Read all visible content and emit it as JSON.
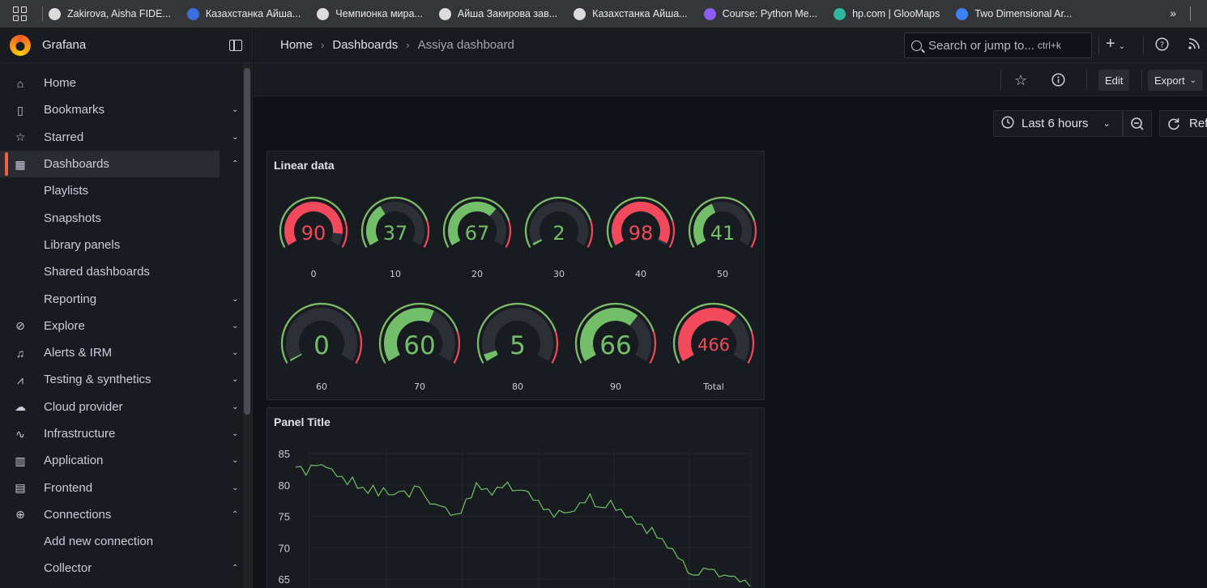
{
  "browser": {
    "bookmarks": [
      {
        "label": "Zakirova, Aisha FIDE...",
        "color": "#dcdcdc"
      },
      {
        "label": "Казахстанка Айша...",
        "color": "#3b6fe0"
      },
      {
        "label": "Чемпионка мира...",
        "color": "#dcdcdc"
      },
      {
        "label": "Айша Закирова зав...",
        "color": "#dcdcdc"
      },
      {
        "label": "Казахстанка Айша...",
        "color": "#dcdcdc"
      },
      {
        "label": "Course: Python Me...",
        "color": "#8b5cf6"
      },
      {
        "label": "hp.com | GlooMaps",
        "color": "#2fb5a0"
      },
      {
        "label": "Two Dimensional Ar...",
        "color": "#3b82f6"
      }
    ],
    "more": "»"
  },
  "sidebar": {
    "brand": "Grafana",
    "items": [
      {
        "label": "Home",
        "icon": "home-icon",
        "glyph": "⌂",
        "chev": ""
      },
      {
        "label": "Bookmarks",
        "icon": "bookmark-icon",
        "glyph": "▯",
        "chev": "⌄"
      },
      {
        "label": "Starred",
        "icon": "star-icon",
        "glyph": "☆",
        "chev": "⌄"
      },
      {
        "label": "Dashboards",
        "icon": "dashboards-icon",
        "glyph": "▦",
        "chev": "⌃",
        "active": true
      },
      {
        "label": "Playlists",
        "icon": "",
        "glyph": "",
        "chev": ""
      },
      {
        "label": "Snapshots",
        "icon": "",
        "glyph": "",
        "chev": ""
      },
      {
        "label": "Library panels",
        "icon": "",
        "glyph": "",
        "chev": ""
      },
      {
        "label": "Shared dashboards",
        "icon": "",
        "glyph": "",
        "chev": ""
      },
      {
        "label": "Reporting",
        "icon": "",
        "glyph": "",
        "chev": "⌄"
      },
      {
        "label": "Explore",
        "icon": "compass-icon",
        "glyph": "⊘",
        "chev": "⌄"
      },
      {
        "label": "Alerts & IRM",
        "icon": "bell-icon",
        "glyph": "♫",
        "chev": "⌄"
      },
      {
        "label": "Testing & synthetics",
        "icon": "chart-test-icon",
        "glyph": "⩘",
        "chev": "⌄"
      },
      {
        "label": "Cloud provider",
        "icon": "cloud-icon",
        "glyph": "☁",
        "chev": "⌄"
      },
      {
        "label": "Infrastructure",
        "icon": "pulse-icon",
        "glyph": "∿",
        "chev": "⌄"
      },
      {
        "label": "Application",
        "icon": "bars-icon",
        "glyph": "▥",
        "chev": "⌄"
      },
      {
        "label": "Frontend",
        "icon": "frontend-icon",
        "glyph": "▤",
        "chev": "⌄"
      },
      {
        "label": "Connections",
        "icon": "connections-icon",
        "glyph": "⊕",
        "chev": "⌃"
      },
      {
        "label": "Add new connection",
        "icon": "",
        "glyph": "",
        "chev": ""
      },
      {
        "label": "Collector",
        "icon": "",
        "glyph": "",
        "chev": "⌃"
      }
    ]
  },
  "header": {
    "breadcrumbs": [
      "Home",
      "Dashboards",
      "Assiya dashboard"
    ],
    "search_placeholder": "Search or jump to...",
    "search_shortcut": "ctrl+k",
    "plus": "+",
    "edit": "Edit",
    "export": "Export"
  },
  "time": {
    "range": "Last 6 hours",
    "refresh": "Ref"
  },
  "panels": {
    "gauge_panel_title": "Linear data",
    "line_panel_title": "Panel Title"
  },
  "gauges": [
    {
      "value": 90,
      "label": "0",
      "color": "#f2495c"
    },
    {
      "value": 37,
      "label": "10",
      "color": "#73bf69"
    },
    {
      "value": 67,
      "label": "20",
      "color": "#73bf69"
    },
    {
      "value": 2,
      "label": "30",
      "color": "#73bf69"
    },
    {
      "value": 98,
      "label": "40",
      "color": "#f2495c"
    },
    {
      "value": 41,
      "label": "50",
      "color": "#73bf69"
    },
    {
      "value": 0,
      "label": "60",
      "color": "#73bf69"
    },
    {
      "value": 60,
      "label": "70",
      "color": "#73bf69"
    },
    {
      "value": 5,
      "label": "80",
      "color": "#73bf69"
    },
    {
      "value": 66,
      "label": "90",
      "color": "#73bf69"
    },
    {
      "value": 466,
      "label": "Total",
      "color": "#f2495c"
    }
  ],
  "chart_data": {
    "type": "line",
    "title": "Panel Title",
    "y_ticks": [
      85,
      80,
      75,
      70,
      65
    ],
    "ylim": [
      64,
      86
    ],
    "grid": true,
    "series": [
      {
        "color": "#73bf69",
        "values": [
          83.2,
          82.6,
          81.9,
          82.8,
          83.4,
          82.9,
          83.1,
          82.2,
          81.7,
          81.0,
          80.4,
          80.9,
          79.8,
          79.3,
          79.0,
          79.6,
          78.6,
          79.2,
          78.8,
          78.1,
          79.3,
          78.7,
          78.4,
          79.5,
          80.0,
          77.9,
          77.3,
          76.6,
          77.0,
          76.1,
          75.5,
          75.0,
          75.8,
          77.4,
          78.3,
          80.0,
          79.6,
          79.1,
          78.7,
          79.3,
          79.9,
          80.1,
          79.4,
          78.8,
          79.5,
          78.6,
          77.9,
          77.2,
          76.4,
          75.8,
          75.2,
          75.6,
          75.9,
          75.3,
          76.2,
          76.8,
          77.5,
          78.2,
          76.9,
          76.1,
          76.7,
          77.2,
          76.3,
          75.8,
          75.2,
          74.6,
          74.1,
          73.4,
          72.6,
          72.9,
          71.9,
          71.1,
          70.3,
          69.5,
          68.7,
          67.6,
          66.3,
          65.3,
          66.0,
          66.4,
          66.9,
          66.2,
          65.7,
          65.3,
          65.8,
          65.1,
          64.9,
          64.5,
          64.2
        ]
      }
    ]
  }
}
